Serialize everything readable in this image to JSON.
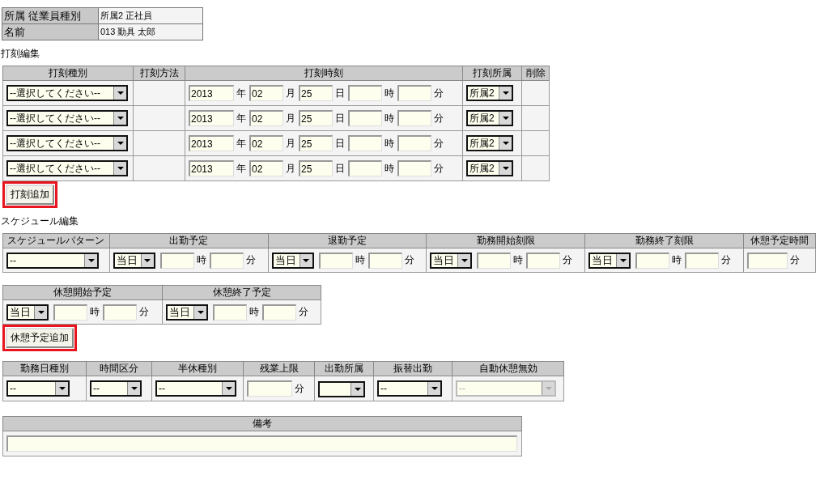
{
  "info": [
    {
      "label": "所属 従業員種別",
      "value": "所属2 正社員"
    },
    {
      "label": "名前",
      "value": "013 勤具 太郎"
    }
  ],
  "punch": {
    "title": "打刻編集",
    "columns": [
      "打刻種別",
      "打刻方法",
      "打刻時刻",
      "打刻所属",
      "削除"
    ],
    "rows": [
      {
        "type": "--選択してください--",
        "year": "2013",
        "year_unit": "年",
        "month": "02",
        "month_unit": "月",
        "day": "25",
        "day_unit": "日",
        "hour_unit": "時",
        "minute_unit": "分",
        "affiliation": "所属2"
      },
      {
        "type": "--選択してください--",
        "year": "2013",
        "year_unit": "年",
        "month": "02",
        "month_unit": "月",
        "day": "25",
        "day_unit": "日",
        "hour_unit": "時",
        "minute_unit": "分",
        "affiliation": "所属2"
      },
      {
        "type": "--選択してください--",
        "year": "2013",
        "year_unit": "年",
        "month": "02",
        "month_unit": "月",
        "day": "25",
        "day_unit": "日",
        "hour_unit": "時",
        "minute_unit": "分",
        "affiliation": "所属2"
      },
      {
        "type": "--選択してください--",
        "year": "2013",
        "year_unit": "年",
        "month": "02",
        "month_unit": "月",
        "day": "25",
        "day_unit": "日",
        "hour_unit": "時",
        "minute_unit": "分",
        "affiliation": "所属2"
      }
    ],
    "button": {
      "label": "打刻追加",
      "highlighted": true
    }
  },
  "schedule": {
    "title": "スケジュール編集",
    "columns": [
      "スケジュールパターン",
      "出勤予定",
      "退勤予定",
      "勤務開始刻限",
      "勤務終了刻限",
      "休憩予定時間"
    ],
    "cells": [
      {
        "kind": "select",
        "value": "--",
        "disabled": false
      },
      {
        "kind": "time",
        "day": "当日",
        "hour_unit": "時",
        "minute_unit": "分"
      },
      {
        "kind": "time",
        "day": "当日",
        "hour_unit": "時",
        "minute_unit": "分"
      },
      {
        "kind": "time",
        "day": "当日",
        "hour_unit": "時",
        "minute_unit": "分"
      },
      {
        "kind": "time",
        "day": "当日",
        "hour_unit": "時",
        "minute_unit": "分"
      },
      {
        "kind": "minutes",
        "unit": "分"
      }
    ]
  },
  "breaks": {
    "columns": [
      "休憩開始予定",
      "休憩終了予定"
    ],
    "cells": [
      {
        "kind": "time",
        "day": "当日",
        "hour_unit": "時",
        "minute_unit": "分"
      },
      {
        "kind": "time",
        "day": "当日",
        "hour_unit": "時",
        "minute_unit": "分"
      }
    ],
    "button": {
      "label": "休憩予定追加",
      "highlighted": true
    }
  },
  "attributes": {
    "columns": [
      "勤務日種別",
      "時間区分",
      "半休種別",
      "残業上限",
      "出勤所属",
      "振替出勤",
      "自動休憩無効"
    ],
    "cells": [
      {
        "kind": "select",
        "value": "--",
        "disabled": false
      },
      {
        "kind": "select",
        "value": "--",
        "disabled": false
      },
      {
        "kind": "select",
        "value": "--",
        "disabled": false
      },
      {
        "kind": "minutes",
        "unit": "分"
      },
      {
        "kind": "select",
        "disabled": false
      },
      {
        "kind": "select",
        "value": "--",
        "disabled": false
      },
      {
        "kind": "select",
        "value": "--",
        "disabled": true
      }
    ]
  },
  "remarks": {
    "columns": [
      "備考"
    ]
  }
}
